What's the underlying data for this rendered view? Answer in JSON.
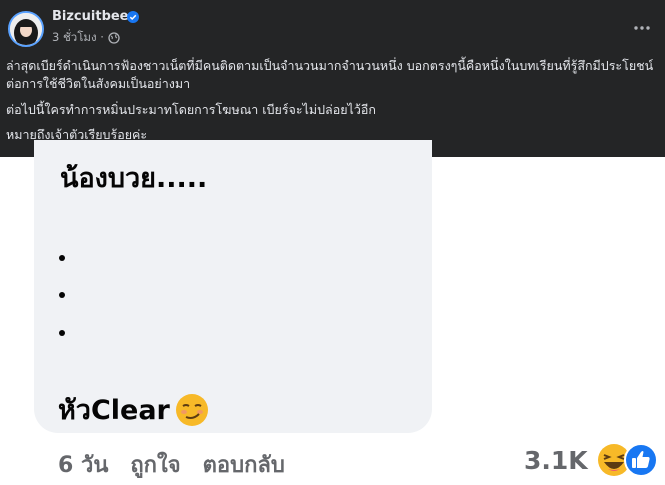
{
  "post": {
    "author": "Bizcuitbeer",
    "time": "3 ชั่วโมง ·",
    "caption_1": "ล่าสุดเบียร์ดำเนินการฟ้องชาวเน็ตที่มีคนติดตามเป็นจำนวนมากจำนวนหนึ่ง บอกตรงๆนี้คือหนึ่งในบทเรียนที่รู้สึกมีประโยชน์ต่อการใช้ชีวิตในสังคมเป็นอย่างมา",
    "caption_2": "ต่อไปนี้ใครทำการหมิ่นประมาทโดยการโฆษณา เบียร์จะไม่ปล่อยไว้อีก",
    "caption_3": "หมายถึงเจ้าตัวเรียบร้อยค่ะ"
  },
  "comment": {
    "line1": "น้องบวย.....",
    "dots": [
      "•",
      "•",
      "•"
    ],
    "last_line": "หัวClear",
    "age": "6 วัน",
    "like_label": "ถูกใจ",
    "reply_label": "ตอบกลับ",
    "reaction_count": "3.1K"
  },
  "icons": {
    "verified": "verified-badge-icon",
    "globe": "globe-icon",
    "more": "more-dots-icon",
    "smirk": "smirk-emoji-icon",
    "haha": "haha-reaction-icon",
    "like": "like-reaction-icon"
  },
  "colors": {
    "header_bg": "#242526",
    "accent_blue": "#1877f2",
    "haha_yellow": "#f7b928"
  }
}
